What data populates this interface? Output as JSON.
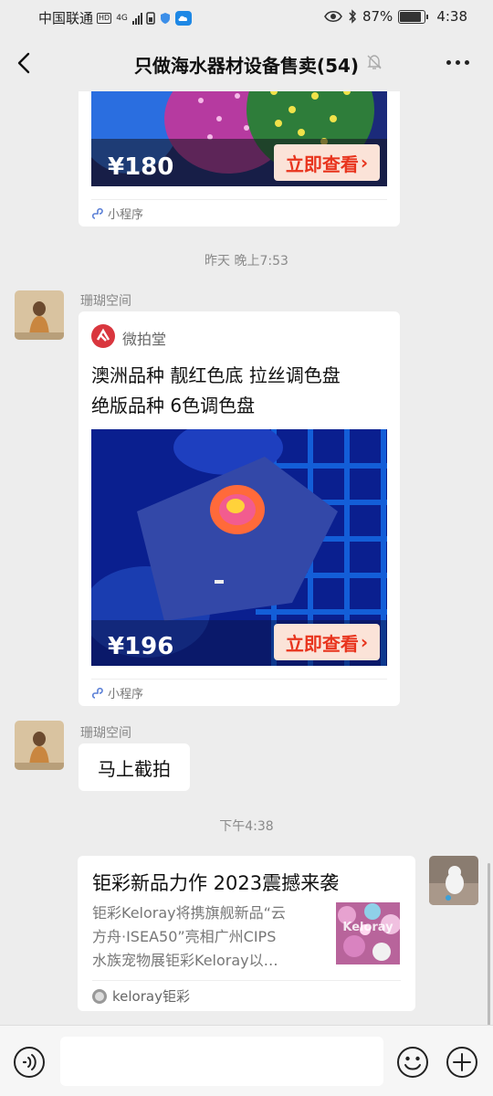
{
  "status_bar": {
    "carrier": "中国联通",
    "hd_badge": "HD",
    "network": "4G",
    "battery": "87%",
    "battery_level": 0.87,
    "time": "4:38"
  },
  "header": {
    "title": "只做海水器材设备售卖(54)",
    "icons": [
      "back-icon",
      "mute-icon",
      "more-icon"
    ]
  },
  "messages": {
    "mini1": {
      "price": "¥180",
      "buy_label": "立即查看",
      "footer": "小程序"
    },
    "time1": "昨天 晚上7:53",
    "mini2": {
      "sender": "珊瑚空间",
      "app_name": "微拍堂",
      "title_line1": "澳洲品种 靓红色底 拉丝调色盘",
      "title_line2": "绝版品种 6色调色盘",
      "price": "¥196",
      "buy_label": "立即查看",
      "footer": "小程序"
    },
    "text1": {
      "sender": "珊瑚空间",
      "text": "马上截拍"
    },
    "time2": "下午4:38",
    "article": {
      "title": "钜彩新品力作 2023震撼来袭",
      "desc_line1": "钜彩Keloray将携旗舰新品“云",
      "desc_line2": "方舟·ISEA50”亮相广州CIPS",
      "desc_line3": "水族宠物展钜彩Keloray以…",
      "thumb_text": "Keloray",
      "source": "keloray钜彩"
    }
  },
  "input": {
    "placeholder": ""
  },
  "colors": {
    "background": "#ededed",
    "bubble": "#ffffff",
    "buy_text": "#e8341d",
    "buy_bg": "#fbe3d8",
    "weipaitang": "#d9363e"
  }
}
